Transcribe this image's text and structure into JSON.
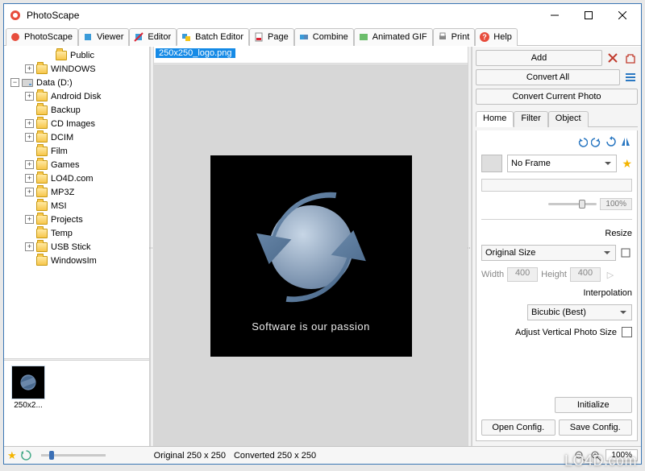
{
  "app": {
    "title": "PhotoScape"
  },
  "tabs": [
    {
      "label": "PhotoScape"
    },
    {
      "label": "Viewer"
    },
    {
      "label": "Editor"
    },
    {
      "label": "Batch Editor"
    },
    {
      "label": "Page"
    },
    {
      "label": "Combine"
    },
    {
      "label": "Animated GIF"
    },
    {
      "label": "Print"
    },
    {
      "label": "Help"
    }
  ],
  "tree": {
    "items": [
      {
        "indent": 2,
        "toggle": " ",
        "icon": "folder",
        "label": "Public"
      },
      {
        "indent": 1,
        "toggle": "+",
        "icon": "folder",
        "label": "WINDOWS"
      },
      {
        "indent": 0,
        "toggle": "−",
        "icon": "disk",
        "label": "Data (D:)"
      },
      {
        "indent": 1,
        "toggle": "+",
        "icon": "folder",
        "label": "Android Disk"
      },
      {
        "indent": 1,
        "toggle": " ",
        "icon": "folder",
        "label": "Backup"
      },
      {
        "indent": 1,
        "toggle": "+",
        "icon": "folder",
        "label": "CD Images"
      },
      {
        "indent": 1,
        "toggle": "+",
        "icon": "folder",
        "label": "DCIM"
      },
      {
        "indent": 1,
        "toggle": " ",
        "icon": "folder",
        "label": "Film"
      },
      {
        "indent": 1,
        "toggle": "+",
        "icon": "folder",
        "label": "Games"
      },
      {
        "indent": 1,
        "toggle": "+",
        "icon": "folder",
        "label": "LO4D.com"
      },
      {
        "indent": 1,
        "toggle": "+",
        "icon": "folder",
        "label": "MP3Z"
      },
      {
        "indent": 1,
        "toggle": " ",
        "icon": "folder",
        "label": "MSI"
      },
      {
        "indent": 1,
        "toggle": "+",
        "icon": "folder",
        "label": "Projects"
      },
      {
        "indent": 1,
        "toggle": " ",
        "icon": "folder",
        "label": "Temp"
      },
      {
        "indent": 1,
        "toggle": "+",
        "icon": "folder",
        "label": "USB Stick"
      },
      {
        "indent": 1,
        "toggle": " ",
        "icon": "folder",
        "label": "WindowsIm"
      }
    ]
  },
  "thumb": {
    "filename": "250x2..."
  },
  "file": {
    "selected": "250x250_logo.png"
  },
  "preview": {
    "caption": "Software is our passion"
  },
  "panel": {
    "add": "Add",
    "convert_all": "Convert All",
    "convert_current": "Convert Current Photo",
    "subtabs": {
      "home": "Home",
      "filter": "Filter",
      "object": "Object"
    },
    "frame": {
      "value": "No Frame"
    },
    "opacity": {
      "value": "100%"
    },
    "resize": {
      "label": "Resize",
      "mode": "Original Size",
      "width_label": "Width",
      "width": "400",
      "height_label": "Height",
      "height": "400"
    },
    "interp": {
      "label": "Interpolation",
      "value": "Bicubic (Best)"
    },
    "adjust_label": "Adjust Vertical Photo Size",
    "initialize": "Initialize",
    "open_config": "Open Config.",
    "save_config": "Save Config."
  },
  "status": {
    "original": "Original 250 x 250",
    "converted": "Converted 250 x 250",
    "zoom": "100%"
  },
  "watermark": "LO4D.com"
}
